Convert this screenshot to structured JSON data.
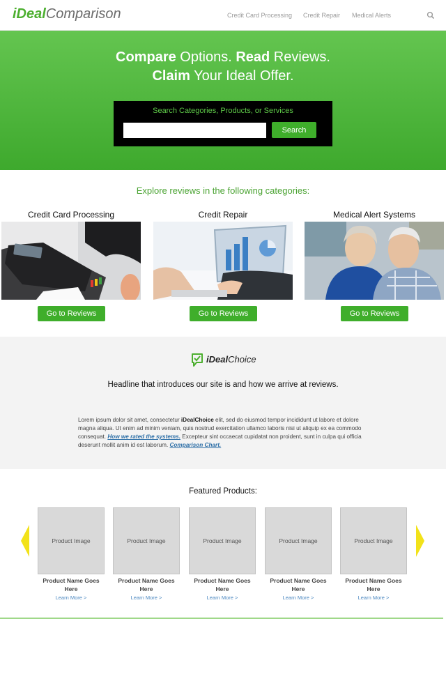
{
  "brand": {
    "logo_part1": "iDeal",
    "logo_part2": "Comparison",
    "accent": "#4caf2f"
  },
  "nav": {
    "items": [
      "Credit Card Processing",
      "Credit Repair",
      "Medical Alerts"
    ],
    "search_icon": "search-icon"
  },
  "hero": {
    "line1_bold1": "Compare",
    "line1_rest1": " Options. ",
    "line1_bold2": "Read",
    "line1_rest2": " Reviews.",
    "line2_bold": "Claim",
    "line2_rest": " Your Ideal Offer.",
    "search_label": "Search Categories, Products, or Services",
    "search_value": "",
    "search_button": "Search"
  },
  "categories": {
    "heading": "Explore reviews in the following categories:",
    "items": [
      {
        "title": "Credit Card Processing",
        "button": "Go to Reviews"
      },
      {
        "title": "Credit Repair",
        "button": "Go to Reviews"
      },
      {
        "title": "Medical Alert Systems",
        "button": "Go to Reviews"
      }
    ]
  },
  "ideal_choice": {
    "logo_bold": "iDeal",
    "logo_rest": "Choice",
    "headline": "Headline that introduces our site is and how we arrive at reviews.",
    "body_1": "Lorem ipsum dolor sit amet, consectetur ",
    "body_bold": "iDealChoice",
    "body_2": " elit, sed do eiusmod tempor incididunt ut labore et dolore magna aliqua. Ut enim ad minim veniam, quis nostrud exercitation ullamco laboris nisi ut aliquip ex ea commodo consequat. ",
    "link_1": "How we rated the systems.",
    "body_3": " Excepteur sint occaecat cupidatat non proident, sunt in culpa qui officia deserunt mollit anim id est laborum. ",
    "link_2": "Comparison Chart."
  },
  "featured": {
    "title": "Featured Products:",
    "products": [
      {
        "image": "Product Image",
        "name": "Product Name Goes Here",
        "link": "Learn More >"
      },
      {
        "image": "Product Image",
        "name": "Product Name Goes Here",
        "link": "Learn More >"
      },
      {
        "image": "Product Image",
        "name": "Product Name Goes Here",
        "link": "Learn More >"
      },
      {
        "image": "Product Image",
        "name": "Product Name Goes Here",
        "link": "Learn More >"
      },
      {
        "image": "Product Image",
        "name": "Product Name Goes Here",
        "link": "Learn More >"
      }
    ]
  }
}
